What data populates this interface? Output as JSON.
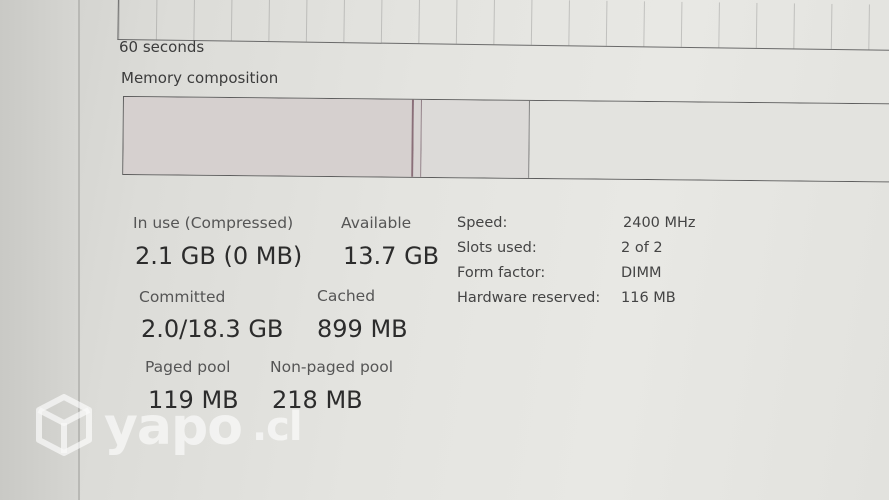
{
  "graph": {
    "time_label": "60 seconds"
  },
  "memory_composition": {
    "label": "Memory composition"
  },
  "stats": {
    "in_use": {
      "label": "In use (Compressed)",
      "value": "2.1 GB (0 MB)"
    },
    "available": {
      "label": "Available",
      "value": "13.7 GB"
    },
    "committed": {
      "label": "Committed",
      "value": "2.0/18.3 GB"
    },
    "cached": {
      "label": "Cached",
      "value": "899 MB"
    },
    "paged_pool": {
      "label": "Paged pool",
      "value": "119 MB"
    },
    "non_paged_pool": {
      "label": "Non-paged pool",
      "value": "218 MB"
    }
  },
  "details": {
    "speed": {
      "label": "Speed:",
      "value": "2400 MHz"
    },
    "slots_used": {
      "label": "Slots used:",
      "value": "2 of 2"
    },
    "form_factor": {
      "label": "Form factor:",
      "value": "DIMM"
    },
    "hardware_reserved": {
      "label": "Hardware reserved:",
      "value": "116 MB"
    }
  },
  "watermark": {
    "brand": "yapo",
    "suffix": ".cl",
    "icon": "cube-icon"
  },
  "colors": {
    "in_use_segment": "#d6d0cf",
    "modified_segment_border": "#8a6f79",
    "graph_border": "#6a6a6a"
  }
}
